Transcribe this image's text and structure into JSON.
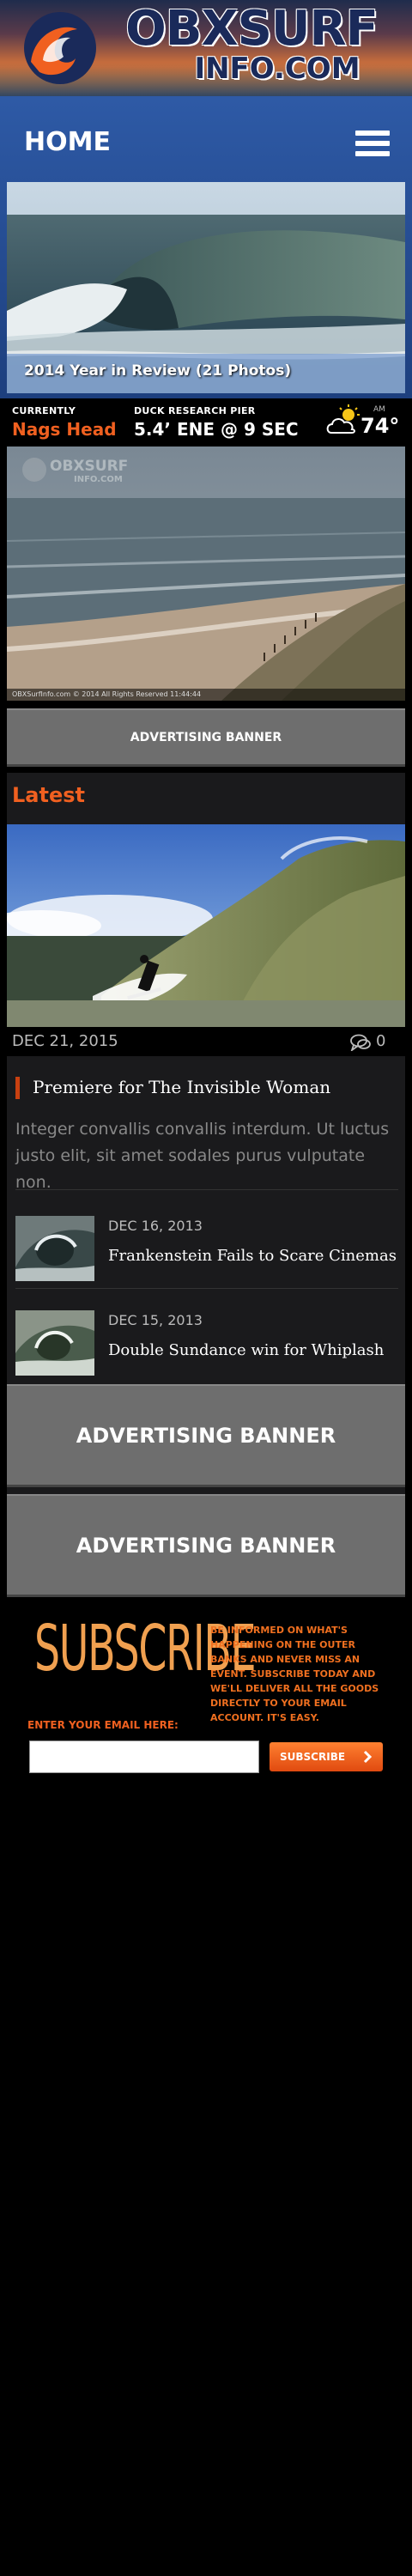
{
  "brand": {
    "line1": "OBXSURF",
    "line2": "INFO.COM",
    "colors": {
      "accent": "#f06020",
      "navy": "#1a2a5a",
      "hero_blue": "#244a8c"
    }
  },
  "nav": {
    "title": "HOME",
    "menu_icon": "hamburger-menu-icon"
  },
  "hero": {
    "caption": "2014 Year in Review (21 Photos)"
  },
  "conditions": {
    "currently_label": "CURRENTLY",
    "location": "Nags Head",
    "pier_label": "DUCK RESEARCH PIER",
    "surf": "5.4’ ENE @ 9 SEC",
    "weather_small": "AM",
    "temperature": "74°",
    "weather_icon": "partly-cloudy-icon"
  },
  "cam": {
    "watermark_line1": "OBXSURF",
    "watermark_line2": "INFO.COM",
    "footer": "OBXSurfInfo.com   © 2014 All Rights Reserved   11:44:44"
  },
  "ads": {
    "small": "ADVERTISING BANNER",
    "big1": "ADVERTISING BANNER",
    "big2": "ADVERTISING BANNER"
  },
  "latest": {
    "heading": "Latest",
    "feature": {
      "date": "DEC 21, 2015",
      "comment_count": "0",
      "title": "Premiere for The Invisible Woman",
      "excerpt": "Integer convallis convallis interdum. Ut luctus justo elit, sit amet sodales purus vulputate non."
    },
    "posts": [
      {
        "date": "DEC 16, 2013",
        "title": "Frankenstein Fails to Scare Cinemas"
      },
      {
        "date": "DEC 15, 2013",
        "title": "Double Sundance win for Whiplash"
      }
    ]
  },
  "subscribe": {
    "heading": "SUBSCRIBE",
    "blurb": "BE INFORMED ON WHAT'S HAPPENING ON THE OUTER BANKS AND NEVER MISS AN EVENT. SUBSCRIBE TODAY AND WE'LL DELIVER ALL THE GOODS DIRECTLY TO YOUR EMAIL ACCOUNT. IT'S EASY.",
    "email_label": "ENTER YOUR EMAIL HERE:",
    "email_value": "",
    "email_placeholder": "",
    "button_label": "SUBSCRIBE"
  }
}
